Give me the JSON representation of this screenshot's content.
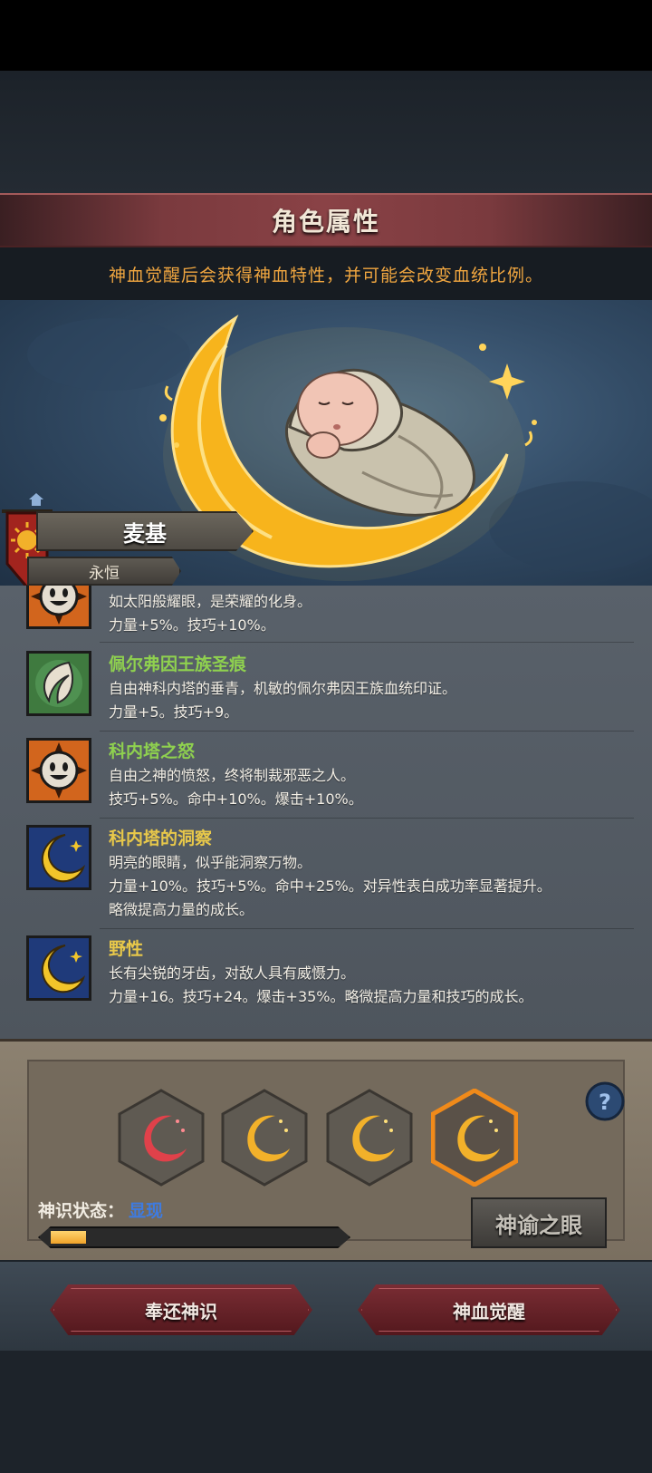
{
  "header": {
    "title": "角色属性",
    "notice": "神血觉醒后会获得神血特性，并可能会改变血统比例。"
  },
  "hero": {
    "name": "麦基",
    "subtitle": "永恒"
  },
  "traits": [
    {
      "name": "",
      "name_color": "#e8c84a",
      "icon": "sun-face-icon",
      "lines": [
        "如太阳般耀眼，是荣耀的化身。",
        "力量+5%。技巧+10%。"
      ]
    },
    {
      "name": "佩尔弗因王族圣痕",
      "name_color": "#8fd14f",
      "icon": "feather-crest-icon",
      "lines": [
        "自由神科内塔的垂青，机敏的佩尔弗因王族血统印证。",
        "力量+5。技巧+9。"
      ]
    },
    {
      "name": "科内塔之怒",
      "name_color": "#8fd14f",
      "icon": "sun-face-icon",
      "lines": [
        "自由之神的愤怒，终将制裁邪恶之人。",
        "技巧+5%。命中+10%。爆击+10%。"
      ]
    },
    {
      "name": "科内塔的洞察",
      "name_color": "#e8c84a",
      "icon": "crescent-moon-icon",
      "lines": [
        "明亮的眼睛，似乎能洞察万物。",
        "力量+10%。技巧+5%。命中+25%。对异性表白成功率显著提升。",
        "略微提高力量的成长。"
      ]
    },
    {
      "name": "野性",
      "name_color": "#e8c84a",
      "icon": "crescent-moon-icon",
      "lines": [
        "长有尖锐的牙齿，对敌人具有威慑力。",
        "力量+16。技巧+24。爆击+35%。略微提高力量和技巧的成长。"
      ]
    }
  ],
  "awakening": {
    "slots": [
      {
        "icon": "red-crescent-icon",
        "color": "#e0414a",
        "selected": false
      },
      {
        "icon": "gold-crescent-icon",
        "color": "#f2b12a",
        "selected": false
      },
      {
        "icon": "gold-crescent-icon",
        "color": "#f2b12a",
        "selected": false
      },
      {
        "icon": "gold-crescent-icon",
        "color": "#f2b12a",
        "selected": true
      }
    ],
    "state_label": "神识状态：",
    "state_value": "显现",
    "progress_fraction": 0.12,
    "oracle_button": "神谕之眼"
  },
  "footer": {
    "return_button": "奉还神识",
    "awaken_button": "神血觉醒"
  },
  "colors": {
    "accent_orange": "#f0a640",
    "state_blue": "#3e7be0",
    "button_red": "#7a2d34"
  }
}
